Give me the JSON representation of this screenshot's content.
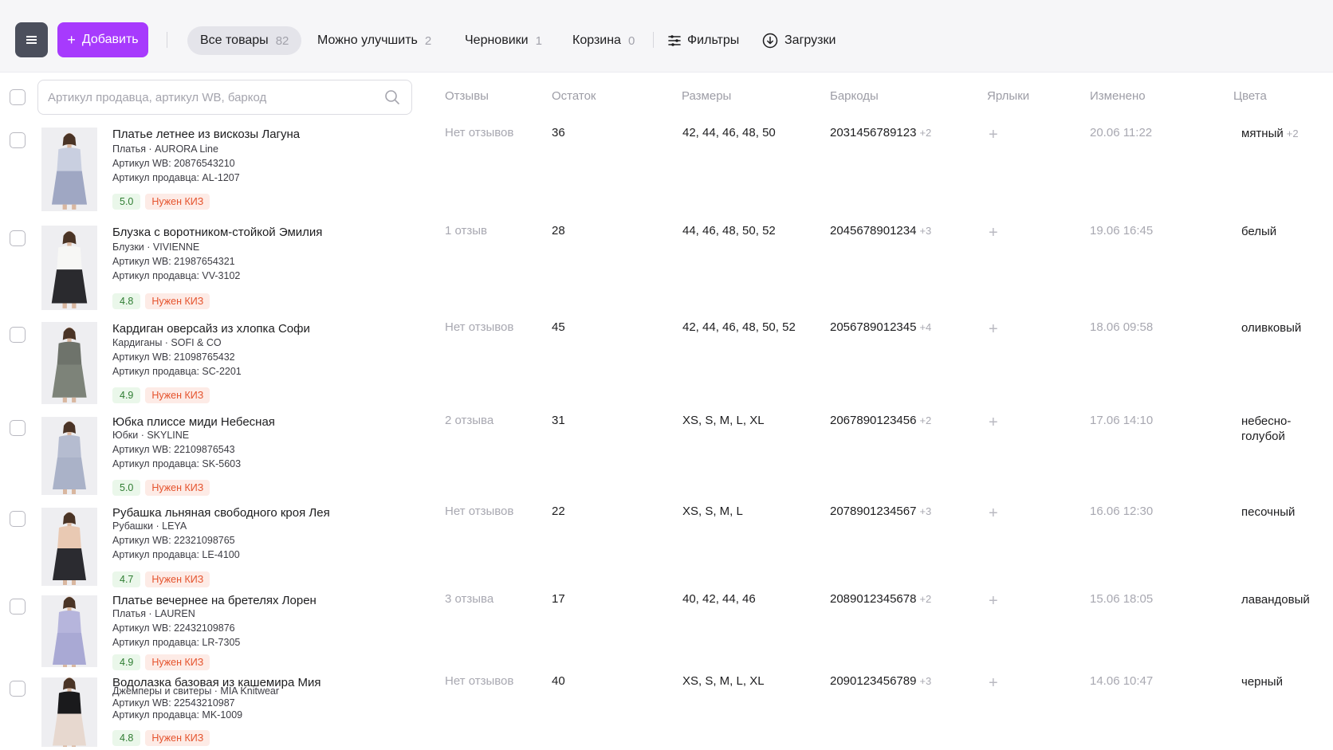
{
  "toolbar": {
    "add_label": "Добавить",
    "tabs": [
      {
        "label": "Все товары",
        "count": "82"
      },
      {
        "label": "Можно улучшить",
        "count": "2"
      },
      {
        "label": "Черновики",
        "count": "1"
      },
      {
        "label": "Корзина",
        "count": "0"
      }
    ],
    "filters_label": "Фильтры",
    "downloads_label": "Загрузки"
  },
  "search": {
    "placeholder": "Артикул продавца, артикул WB, баркод"
  },
  "columns": {
    "reviews": "Отзывы",
    "stock": "Остаток",
    "sizes": "Размеры",
    "barcodes": "Баркоды",
    "labels": "Ярлыки",
    "changed": "Изменено",
    "colors": "Цвета"
  },
  "products": [
    {
      "title": "Платье летнее из вискозы Лагуна",
      "category_brand": "Платья · AURORA Line",
      "wb": "Артикул WB: 20876543210",
      "seller": "Артикул продавца: AL-1207",
      "rating": "5.0",
      "kiz": "Нужен КИЗ",
      "reviews": "Нет отзывов",
      "stock": "36",
      "sizes": "42, 44, 46, 48, 50",
      "barcode": "2031456789123",
      "barcode_extra": "+2",
      "changed": "20.06 11:22",
      "color": "мятный",
      "color_extra": "+2",
      "dress_color": "#9fa7c3",
      "top_color": "#c9cfe0"
    },
    {
      "title": "Блузка с воротником-стойкой Эмилия",
      "category_brand": "Блузки · VIVIENNE",
      "wb": "Артикул WB: 21987654321",
      "seller": "Артикул продавца: VV-3102",
      "rating": "4.8",
      "kiz": "Нужен КИЗ",
      "reviews": "1 отзыв",
      "stock": "28",
      "sizes": "44, 46, 48, 50, 52",
      "barcode": "2045678901234",
      "barcode_extra": "+3",
      "changed": "19.06 16:45",
      "color": "белый",
      "color_extra": "",
      "dress_color": "#2a2a2e",
      "top_color": "#f7f7f5"
    },
    {
      "title": "Кардиган оверсайз из хлопка Софи",
      "category_brand": "Кардиганы · SOFI & CO",
      "wb": "Артикул WB: 21098765432",
      "seller": "Артикул продавца: SC-2201",
      "rating": "4.9",
      "kiz": "Нужен КИЗ",
      "reviews": "Нет отзывов",
      "stock": "45",
      "sizes": "42, 44, 46, 48, 50, 52",
      "barcode": "2056789012345",
      "barcode_extra": "+4",
      "changed": "18.06 09:58",
      "color": "оливковый",
      "color_extra": "",
      "dress_color": "#7d8379",
      "top_color": "#6e736b"
    },
    {
      "title": "Юбка плиссе миди Небесная",
      "category_brand": "Юбки · SKYLINE",
      "wb": "Артикул WB: 22109876543",
      "seller": "Артикул продавца: SK-5603",
      "rating": "5.0",
      "kiz": "Нужен КИЗ",
      "reviews": "2 отзыва",
      "stock": "31",
      "sizes": "XS, S, M, L, XL",
      "barcode": "2067890123456",
      "barcode_extra": "+2",
      "changed": "17.06 14:10",
      "color": "небесно-голубой",
      "color_extra": "",
      "dress_color": "#aab2c8",
      "top_color": "#b5bcd0"
    },
    {
      "title": "Рубашка льняная свободного кроя Лея",
      "category_brand": "Рубашки · LEYA",
      "wb": "Артикул WB: 22321098765",
      "seller": "Артикул продавца: LE-4100",
      "rating": "4.7",
      "kiz": "Нужен КИЗ",
      "reviews": "Нет отзывов",
      "stock": "22",
      "sizes": "XS, S, M, L",
      "barcode": "2078901234567",
      "barcode_extra": "+3",
      "changed": "16.06 12:30",
      "color": "песочный",
      "color_extra": "",
      "dress_color": "#2b2b30",
      "top_color": "#e9c9b3"
    },
    {
      "title": "Платье вечернее на бретелях Лорен",
      "category_brand": "Платья · LAUREN",
      "wb": "Артикул WB: 22432109876",
      "seller": "Артикул продавца: LR-7305",
      "rating": "4.9",
      "kiz": "Нужен КИЗ",
      "reviews": "3 отзыва",
      "stock": "17",
      "sizes": "40, 42, 44, 46",
      "barcode": "2089012345678",
      "barcode_extra": "+2",
      "changed": "15.06 18:05",
      "color": "лавандовый",
      "color_extra": "",
      "dress_color": "#a9a9d4",
      "top_color": "#b6b5dc"
    },
    {
      "title": "Водолазка базовая из кашемира Мия",
      "category_brand": "Джемперы и свитеры · MIA Knitwear",
      "wb": "Артикул WB: 22543210987",
      "seller": "Артикул продавца: MK-1009",
      "rating": "4.8",
      "kiz": "Нужен КИЗ",
      "reviews": "Нет отзывов",
      "stock": "40",
      "sizes": "XS, S, M, L, XL",
      "barcode": "2090123456789",
      "barcode_extra": "+3",
      "changed": "14.06 10:47",
      "color": "черный",
      "color_extra": "",
      "dress_color": "#e7d8cf",
      "top_color": "#1a1a1c"
    }
  ]
}
